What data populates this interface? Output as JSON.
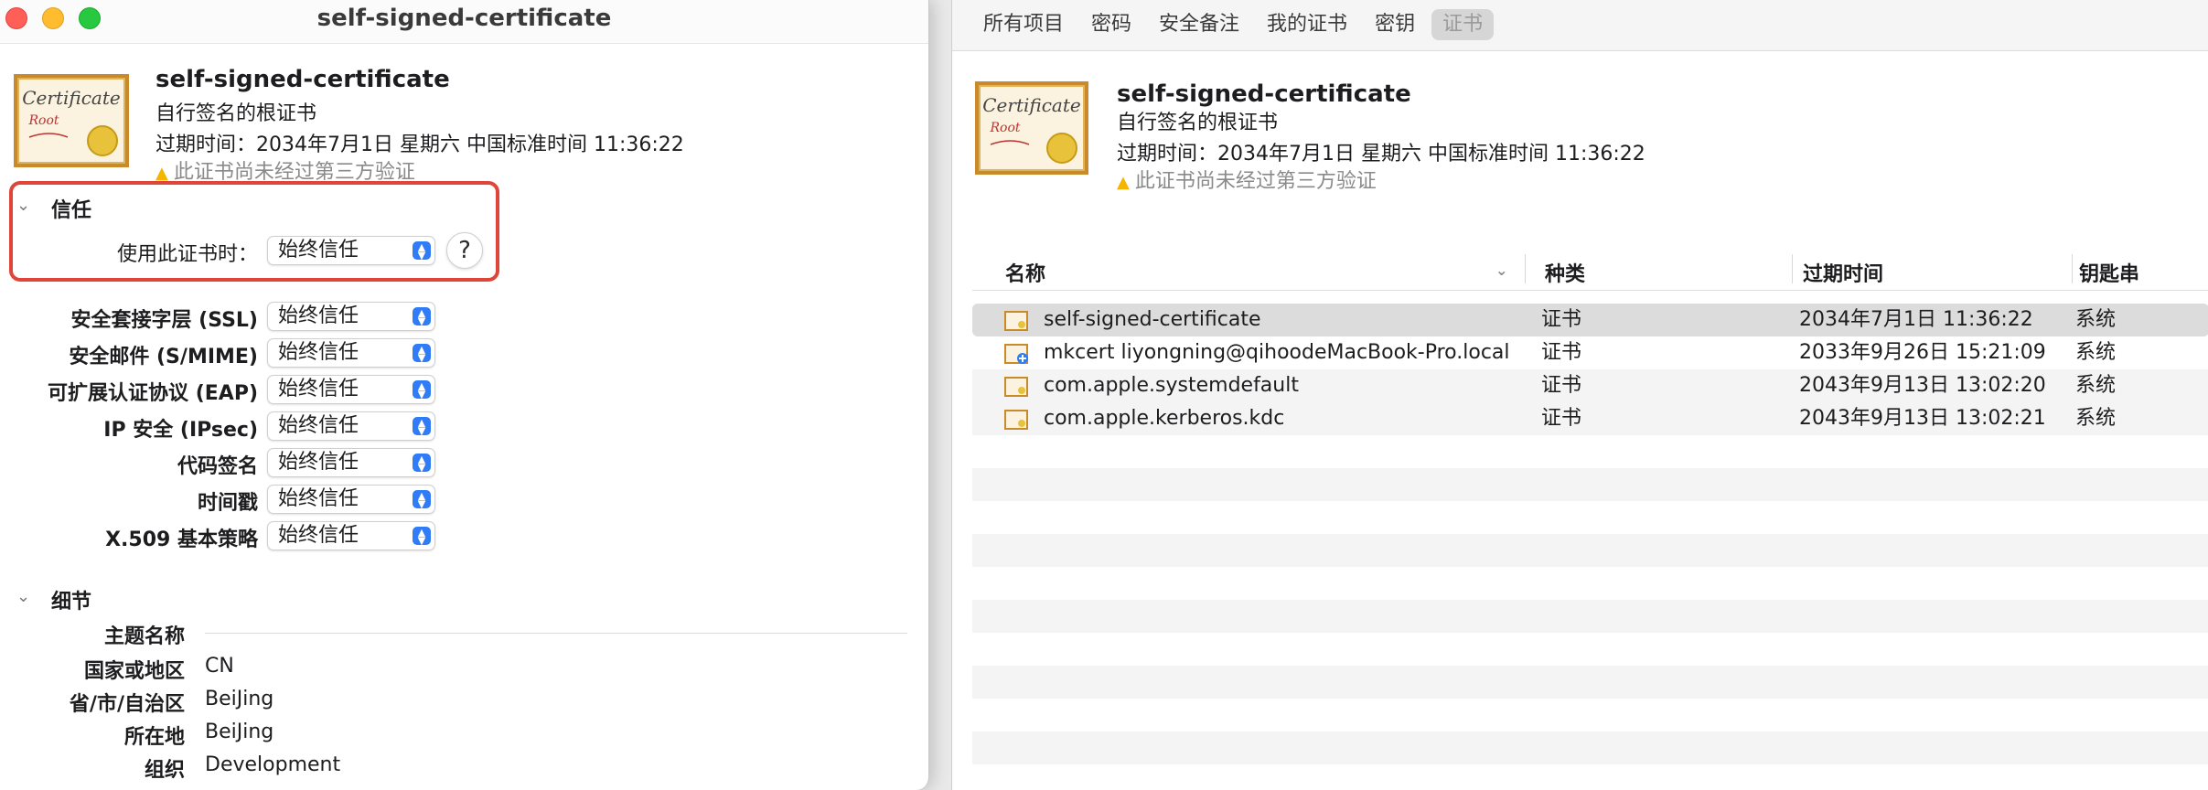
{
  "main_window": {
    "tabs": [
      {
        "label": "所有项目",
        "active": false
      },
      {
        "label": "密码",
        "active": false
      },
      {
        "label": "安全备注",
        "active": false
      },
      {
        "label": "我的证书",
        "active": false
      },
      {
        "label": "密钥",
        "active": false
      },
      {
        "label": "证书",
        "active": true
      }
    ],
    "header": {
      "title": "self-signed-certificate",
      "subtitle": "自行签名的根证书",
      "expiry": "过期时间：2034年7月1日 星期六 中国标准时间 11:36:22",
      "warning": "此证书尚未经过第三方验证",
      "icon": "certificate-root-icon"
    },
    "columns": [
      "名称",
      "种类",
      "过期时间",
      "钥匙串"
    ],
    "rows": [
      {
        "name": "self-signed-certificate",
        "kind": "证书",
        "expires": "2034年7月1日 11:36:22",
        "keychain": "系统",
        "icon": "certificate-icon",
        "selected": true
      },
      {
        "name": "mkcert liyongning@qihoodeMacBook-Pro.local",
        "kind": "证书",
        "expires": "2033年9月26日 15:21:09",
        "keychain": "系统",
        "icon": "certificate-trusted-plus-icon",
        "selected": false
      },
      {
        "name": "com.apple.systemdefault",
        "kind": "证书",
        "expires": "2043年9月13日 13:02:20",
        "keychain": "系统",
        "icon": "certificate-icon",
        "selected": false
      },
      {
        "name": "com.apple.kerberos.kdc",
        "kind": "证书",
        "expires": "2043年9月13日 13:02:21",
        "keychain": "系统",
        "icon": "certificate-icon",
        "selected": false
      }
    ]
  },
  "cert_window": {
    "title": "self-signed-certificate",
    "header": {
      "title": "self-signed-certificate",
      "subtitle": "自行签名的根证书",
      "expiry": "过期时间：2034年7月1日 星期六 中国标准时间 11:36:22",
      "warning": "此证书尚未经过第三方验证"
    },
    "trust": {
      "section": "信任",
      "when_using_label": "使用此证书时：",
      "when_using_value": "始终信任",
      "help": "?",
      "settings": [
        {
          "label": "安全套接字层 (SSL)",
          "value": "始终信任"
        },
        {
          "label": "安全邮件 (S/MIME)",
          "value": "始终信任"
        },
        {
          "label": "可扩展认证协议 (EAP)",
          "value": "始终信任"
        },
        {
          "label": "IP 安全 (IPsec)",
          "value": "始终信任"
        },
        {
          "label": "代码签名",
          "value": "始终信任"
        },
        {
          "label": "时间戳",
          "value": "始终信任"
        },
        {
          "label": "X.509 基本策略",
          "value": "始终信任"
        }
      ]
    },
    "details": {
      "section": "细节",
      "subject_name_label": "主题名称",
      "fields": [
        {
          "label": "国家或地区",
          "value": "CN"
        },
        {
          "label": "省/市/自治区",
          "value": "BeiJing"
        },
        {
          "label": "所在地",
          "value": "BeiJing"
        },
        {
          "label": "组织",
          "value": "Development"
        }
      ]
    }
  },
  "colors": {
    "highlight": "#e0453a",
    "accent": "#2f7cf6",
    "warning": "#f4b400"
  }
}
